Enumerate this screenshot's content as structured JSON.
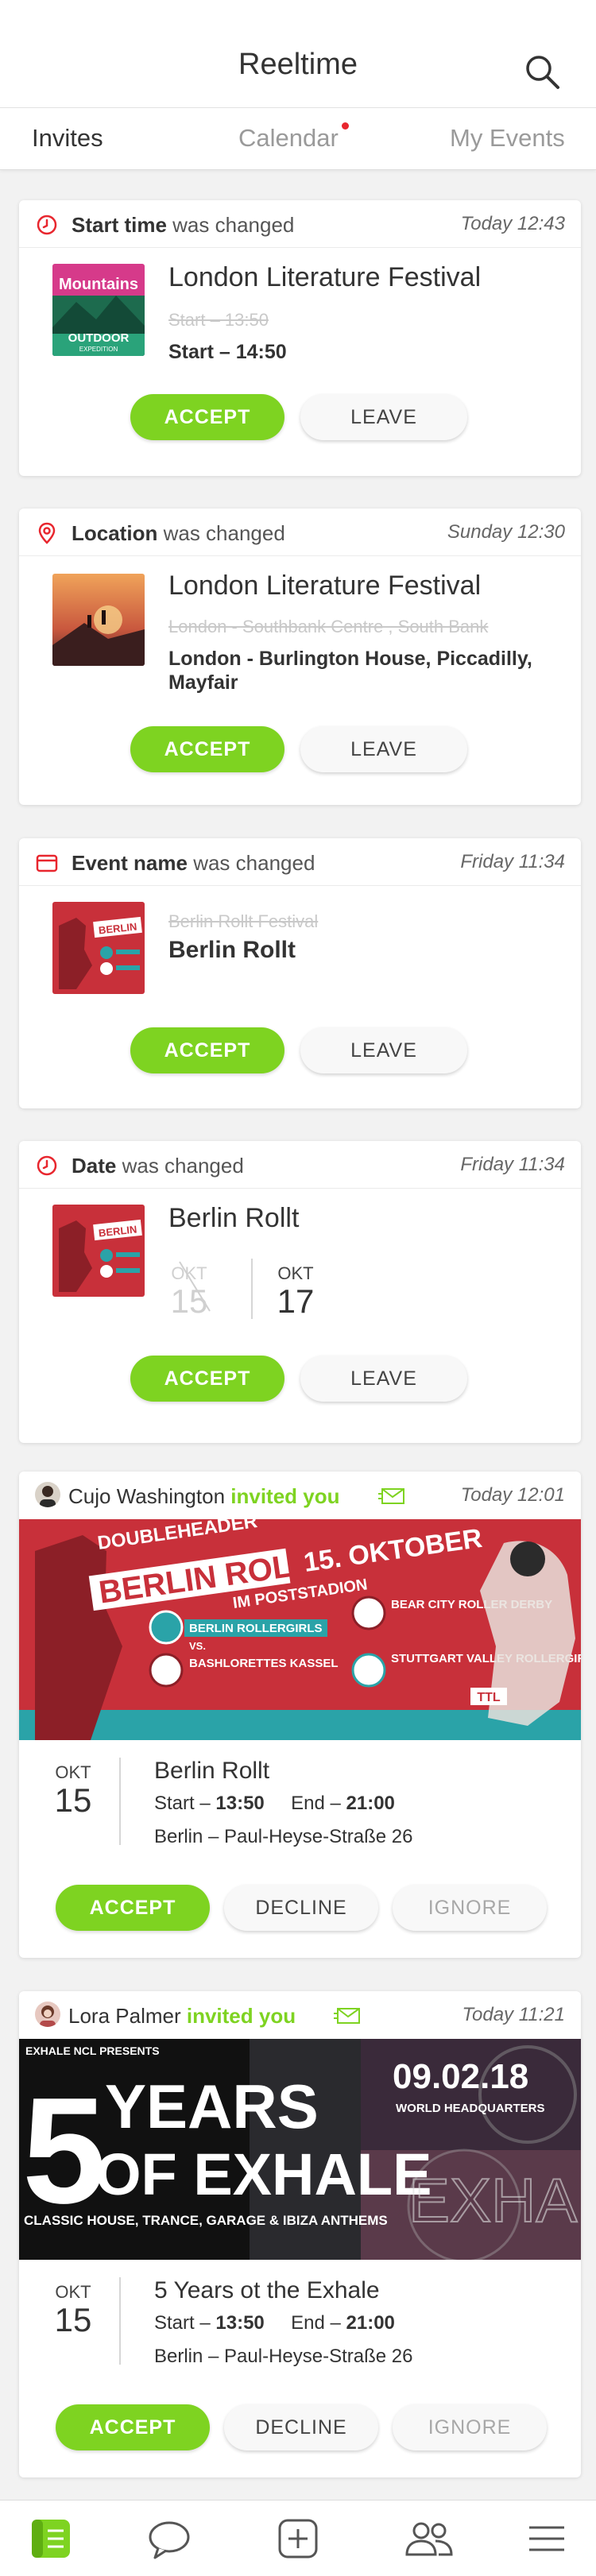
{
  "header": {
    "title": "Reeltime"
  },
  "tabs": [
    {
      "label": "Invites",
      "active": true
    },
    {
      "label": "Calendar",
      "has_notification": true
    },
    {
      "label": "My Events"
    }
  ],
  "changes": [
    {
      "field": "Start time",
      "suffix": "was changed",
      "time": "Today 12:43",
      "event": "London Literature Festival",
      "old_value": "Start – 13:50",
      "new_value": "Start – 14:50",
      "accept": "ACCEPT",
      "leave": "LEAVE"
    },
    {
      "field": "Location",
      "suffix": "was changed",
      "time": "Sunday 12:30",
      "event": "London Literature Festival",
      "old_value": "London - Southbank Centre , South Bank",
      "new_value": "London - Burlington House, Piccadilly, Mayfair",
      "accept": "ACCEPT",
      "leave": "LEAVE"
    },
    {
      "field": "Event name",
      "suffix": "was changed",
      "time": "Friday 11:34",
      "old_value": "Berlin Rollt Festival",
      "new_value": "Berlin Rollt",
      "accept": "ACCEPT",
      "leave": "LEAVE"
    },
    {
      "field": "Date",
      "suffix": "was changed",
      "time": "Friday 11:34",
      "event": "Berlin Rollt",
      "old_month": "OKT",
      "old_day": "15",
      "new_month": "OKT",
      "new_day": "17",
      "accept": "ACCEPT",
      "leave": "LEAVE"
    }
  ],
  "thumbs": {
    "mountains_top": "Mountains",
    "mountains_bottom": "OUTDOOR",
    "mountains_sub": "EXPEDITION",
    "berlin": "BERLIN"
  },
  "invites": [
    {
      "inviter": "Cujo Washington",
      "action": "invited you",
      "time": "Today 12:01",
      "banner": {
        "line1": "DOUBLEHEADER",
        "line2": "BERLIN ROLLT",
        "line3": "15. OKTOBER",
        "line4": "IM POSTSTADION",
        "team1": "BERLIN ROLLERGIRLS",
        "vs": "VS.",
        "team2": "BASHLORETTES KASSEL",
        "team3": "BEAR CITY ROLLER DERBY",
        "team4": "STUTTGART VALLEY ROLLERGIRLS",
        "sponsor": "TTL"
      },
      "month": "OKT",
      "day": "15",
      "title": "Berlin Rollt",
      "start_label": "Start –",
      "start": "13:50",
      "end_label": "End –",
      "end": "21:00",
      "location": "Berlin – Paul-Heyse-Straße 26",
      "accept": "ACCEPT",
      "decline": "DECLINE",
      "ignore": "IGNORE"
    },
    {
      "inviter": "Lora Palmer",
      "action": "invited you",
      "time": "Today 11:21",
      "banner": {
        "presents": "EXHALE NCL PRESENTS",
        "big1": "5",
        "big2": "YEARS",
        "big3": "OF EXHALE",
        "sub": "CLASSIC HOUSE, TRANCE, GARAGE & IBIZA ANTHEMS",
        "date": "09.02.18",
        "venue": "WORLD HEADQUARTERS",
        "ghost": "EXHALE"
      },
      "month": "OKT",
      "day": "15",
      "title": "5 Years ot the Exhale",
      "start_label": "Start –",
      "start": "13:50",
      "end_label": "End –",
      "end": "21:00",
      "location": "Berlin – Paul-Heyse-Straße 26",
      "accept": "ACCEPT",
      "decline": "DECLINE",
      "ignore": "IGNORE"
    }
  ],
  "colors": {
    "accent": "#7ed321",
    "alert": "#e8262e",
    "berlin_red": "#c8303a",
    "teal": "#2aa3a8"
  },
  "nav": [
    {
      "icon": "invites-list-icon",
      "active": true
    },
    {
      "icon": "chat-bubble-icon"
    },
    {
      "icon": "add-event-icon"
    },
    {
      "icon": "people-icon"
    },
    {
      "icon": "menu-icon"
    }
  ]
}
